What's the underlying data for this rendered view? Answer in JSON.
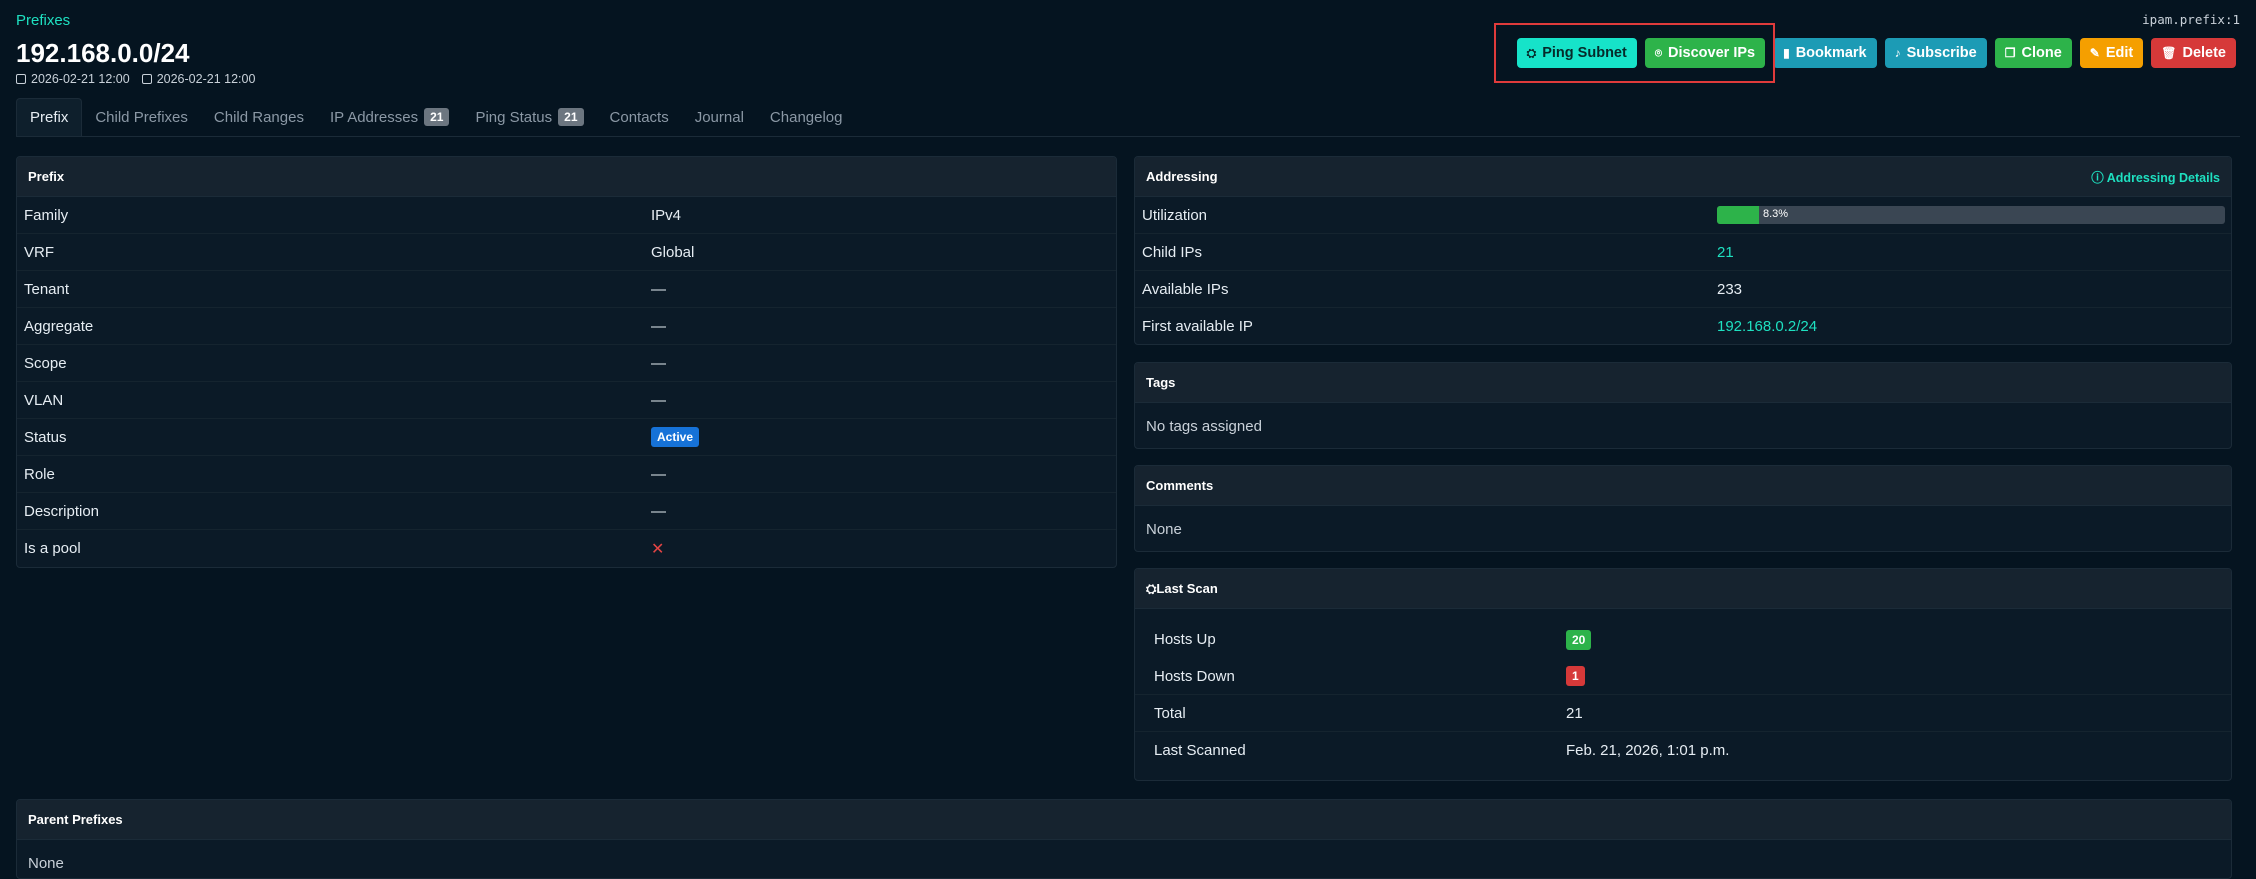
{
  "header": {
    "breadcrumb": "Prefixes",
    "title": "192.168.0.0/24",
    "created": "2026-02-21 12:00",
    "modified": "2026-02-21 12:00",
    "object_id": "ipam.prefix:1"
  },
  "actions": {
    "ping": "Ping Subnet",
    "discover": "Discover IPs",
    "bookmark": "Bookmark",
    "subscribe": "Subscribe",
    "clone": "Clone",
    "edit": "Edit",
    "delete": "Delete"
  },
  "tabs": [
    {
      "label": "Prefix"
    },
    {
      "label": "Child Prefixes"
    },
    {
      "label": "Child Ranges"
    },
    {
      "label": "IP Addresses",
      "count": "21"
    },
    {
      "label": "Ping Status",
      "count": "21"
    },
    {
      "label": "Contacts"
    },
    {
      "label": "Journal"
    },
    {
      "label": "Changelog"
    }
  ],
  "prefix_card": {
    "title": "Prefix",
    "rows": [
      {
        "k": "Family",
        "v": "IPv4"
      },
      {
        "k": "VRF",
        "v": "Global"
      },
      {
        "k": "Tenant",
        "v": "—"
      },
      {
        "k": "Aggregate",
        "v": "—"
      },
      {
        "k": "Scope",
        "v": "—"
      },
      {
        "k": "VLAN",
        "v": "—"
      },
      {
        "k": "Status",
        "v": "Active"
      },
      {
        "k": "Role",
        "v": "—"
      },
      {
        "k": "Description",
        "v": "—"
      },
      {
        "k": "Is a pool",
        "v": "✕"
      }
    ]
  },
  "addressing": {
    "title": "Addressing",
    "details_link": "Addressing Details",
    "utilization_label": "Utilization",
    "utilization_text": "8.3%",
    "utilization_fraction": 0.083,
    "child_ips_label": "Child IPs",
    "child_ips": "21",
    "available_label": "Available IPs",
    "available": "233",
    "first_available_label": "First available IP",
    "first_available": "192.168.0.2/24"
  },
  "tags": {
    "title": "Tags",
    "text": "No tags assigned"
  },
  "comments": {
    "title": "Comments",
    "text": "None"
  },
  "last_scan": {
    "title": "Last Scan",
    "hosts_up_label": "Hosts Up",
    "hosts_up": "20",
    "hosts_down_label": "Hosts Down",
    "hosts_down": "1",
    "total_label": "Total",
    "total": "21",
    "last_scanned_label": "Last Scanned",
    "last_scanned": "Feb. 21, 2026, 1:01 p.m."
  },
  "parent_prefixes": {
    "title": "Parent Prefixes",
    "text": "None"
  },
  "colors": {
    "accent": "#1ee0c0",
    "background": "#051420",
    "success": "#2db34a",
    "danger": "#d63939",
    "warning": "#f59f00",
    "info": "#1c9bb5"
  }
}
